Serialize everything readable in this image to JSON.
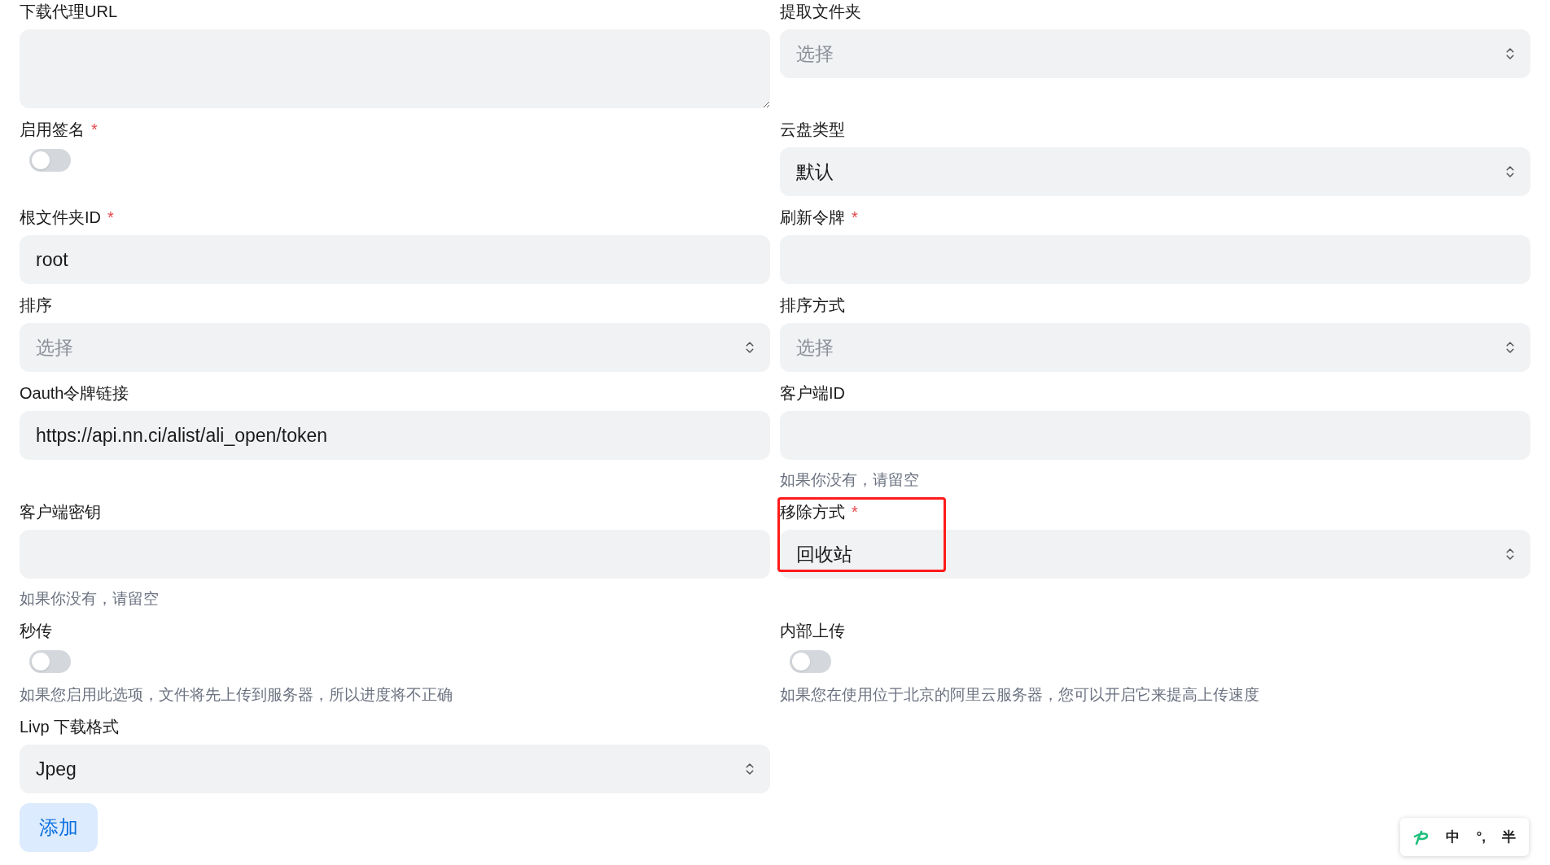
{
  "rows": [
    [
      {
        "kind": "textarea",
        "label": "下载代理URL"
      },
      {
        "kind": "select",
        "label": "提取文件夹",
        "placeholder": "选择"
      }
    ],
    [
      {
        "kind": "switch",
        "label": "启用签名",
        "required_mark": "*",
        "on": false
      },
      {
        "kind": "select",
        "label": "云盘类型",
        "value": "默认"
      }
    ],
    [
      {
        "kind": "input",
        "label": "根文件夹ID",
        "required_mark": "*",
        "value": "root"
      },
      {
        "kind": "input",
        "label": "刷新令牌",
        "required_mark": "*"
      }
    ],
    [
      {
        "kind": "select",
        "label": "排序",
        "placeholder": "选择"
      },
      {
        "kind": "select",
        "label": "排序方式",
        "placeholder": "选择"
      }
    ],
    [
      {
        "kind": "input",
        "label": "Oauth令牌链接",
        "value": "https://api.nn.ci/alist/ali_open/token"
      },
      {
        "kind": "input",
        "label": "客户端ID",
        "hint": "如果你没有，请留空"
      }
    ],
    [
      {
        "kind": "input",
        "label": "客户端密钥",
        "hint": "如果你没有，请留空"
      },
      {
        "kind": "select",
        "label": "移除方式",
        "required_mark": "*",
        "value": "回收站",
        "highlighted": true
      }
    ],
    [
      {
        "kind": "switch",
        "label": "秒传",
        "on": false,
        "hint": "如果您启用此选项，文件将先上传到服务器，所以进度将不正确"
      },
      {
        "kind": "switch",
        "label": "内部上传",
        "on": false,
        "hint": "如果您在使用位于北京的阿里云服务器，您可以开启它来提高上传速度"
      }
    ],
    [
      {
        "kind": "select",
        "label": "Livp 下载格式",
        "value": "Jpeg"
      },
      null
    ]
  ],
  "submit": "添加",
  "ime_bar": {
    "mode": "中",
    "punctuation": "°,",
    "width": "半"
  }
}
